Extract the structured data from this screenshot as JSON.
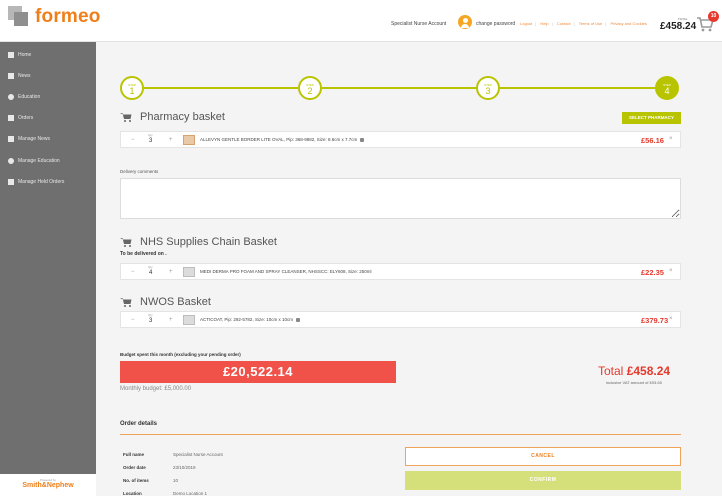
{
  "brand": {
    "name": "formeo"
  },
  "header": {
    "account": "Specialist Nurse Account",
    "change_password": "change password",
    "links": [
      "Logout",
      "Help",
      "Contact",
      "Terms of Use",
      "Privacy and Cookies"
    ],
    "total_label": "TOTAL",
    "total_amount": "£458.24",
    "cart_count": "10"
  },
  "sidebar": {
    "items": [
      {
        "label": "Home",
        "icon": "home-icon"
      },
      {
        "label": "News",
        "icon": "megaphone-icon"
      },
      {
        "label": "Education",
        "icon": "graduation-icon"
      },
      {
        "label": "Orders",
        "icon": "clipboard-icon"
      },
      {
        "label": "Manage News",
        "icon": "megaphone-icon"
      },
      {
        "label": "Manage Education",
        "icon": "graduation-icon"
      },
      {
        "label": "Manage Held Orders",
        "icon": "folder-icon"
      }
    ],
    "footer_powered": "Powered by",
    "footer_brand": "Smith&Nephew"
  },
  "stepper": {
    "steps": [
      {
        "label": "STEP",
        "num": "1"
      },
      {
        "label": "STEP",
        "num": "2"
      },
      {
        "label": "STEP",
        "num": "3"
      },
      {
        "label": "STEP",
        "num": "4"
      }
    ]
  },
  "pharmacy": {
    "title": "Pharmacy basket",
    "select_button": "SELECT PHARMACY",
    "item": {
      "qty_label": "Qty",
      "qty": "3",
      "description": "ALLEVYN GENTLE BORDER LITE OVAL, Pip: 368-9882, Size: 8.6cm x 7.7cm",
      "price": "£56.16"
    }
  },
  "comments": {
    "label": "Delivery comments",
    "value": ""
  },
  "nhs": {
    "title": "NHS Supplies Chain Basket",
    "delivered": "To be delivered on .",
    "item": {
      "qty_label": "Qty",
      "qty": "4",
      "description": "MEDI DERMA PRO FOAM AND SPRAY CLEANSER, NHSSCC: ELY608, Size: 250ml",
      "price": "£22.35"
    }
  },
  "nwos": {
    "title": "NWOS Basket",
    "item": {
      "qty_label": "Qty",
      "qty": "3",
      "description": "ACTICOAT, Pip: 292-5782, Size: 10cm x 10cm",
      "price": "£379.73"
    }
  },
  "budget": {
    "label": "Budget spent this month (excluding your pending order)",
    "spent": "£20,522.14",
    "monthly": "Monthly budget: £5,000.00",
    "total_prefix": "Total",
    "total_amount": "£458.24",
    "vat": "inclusive VAT amount of £93.65"
  },
  "order_details": {
    "title": "Order details",
    "rows": [
      {
        "key": "Full name",
        "value": "Specialist Nurse Account"
      },
      {
        "key": "Order date",
        "value": "23/10/2019"
      },
      {
        "key": "No. of items",
        "value": "10"
      },
      {
        "key": "Location",
        "value": "Demo Location 1"
      }
    ],
    "cancel": "CANCEL",
    "confirm": "CONFIRM"
  },
  "colors": {
    "accent": "#b9c400",
    "brand": "#ef7f1a",
    "danger": "#e5392c",
    "sidebar": "#6f6f6f"
  }
}
